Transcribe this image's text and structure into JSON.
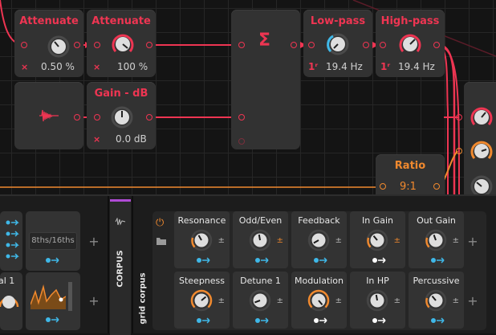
{
  "colors": {
    "accent_red": "#ee3552",
    "accent_orange": "#f0892e",
    "accent_blue": "#3fb8e8",
    "panel_bg": "#333333"
  },
  "modulators": {
    "attenuate_1": {
      "title": "Attenuate",
      "value": "0.50 %",
      "clear_icon": "×"
    },
    "attenuate_2": {
      "title": "Attenuate",
      "value": "100 %",
      "clear_icon": "×"
    },
    "sum": {
      "symbol": "Σ"
    },
    "lowpass": {
      "title": "Low-pass",
      "order": "1ʳ",
      "value": "19.4 Hz"
    },
    "highpass": {
      "title": "High-pass",
      "order": "1ʳ",
      "value": "19.4 Hz"
    },
    "envelope": {
      "icon": "envelope-follower-icon"
    },
    "gain": {
      "title": "Gain - dB",
      "value": "0.0 dB",
      "clear_icon": "×"
    },
    "ratio": {
      "title": "Ratio",
      "value": "9:1"
    }
  },
  "device_panel": {
    "left_partial_label": "al 1",
    "rate_selector": "8ths/16ths",
    "add_label": "+",
    "corpus_tab": "CORPUS",
    "device_label": "grid corpus",
    "params_row1": [
      {
        "name": "Resonance",
        "mod": "±",
        "mod_color": "gray"
      },
      {
        "name": "Odd/Even",
        "mod": "±",
        "mod_color": "orange"
      },
      {
        "name": "Feedback",
        "mod": "±",
        "mod_color": "gray"
      },
      {
        "name": "In Gain",
        "mod": "±",
        "mod_color": "orange"
      },
      {
        "name": "Out Gain",
        "mod": "±",
        "mod_color": "gray"
      }
    ],
    "params_row2": [
      {
        "name": "Steepness",
        "mod": "±",
        "mod_color": "gray"
      },
      {
        "name": "Detune 1",
        "mod": "±",
        "mod_color": "gray"
      },
      {
        "name": "Modulation",
        "mod": "±",
        "mod_color": "gray"
      },
      {
        "name": "In HP",
        "mod": "±",
        "mod_color": "gray"
      },
      {
        "name": "Percussive",
        "mod": "±",
        "mod_color": "gray"
      }
    ]
  }
}
